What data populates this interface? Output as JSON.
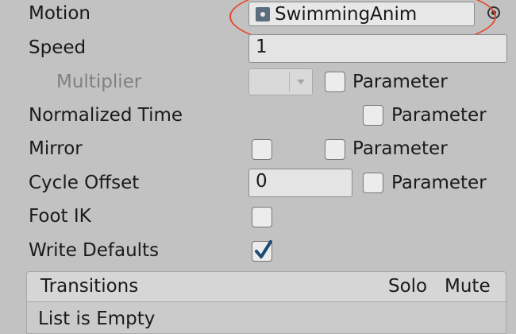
{
  "inspector": {
    "motion": {
      "label": "Motion",
      "value": "SwimmingAnim"
    },
    "speed": {
      "label": "Speed",
      "value": "1"
    },
    "multiplier": {
      "label": "Multiplier",
      "param_label": "Parameter"
    },
    "normalized_time": {
      "label": "Normalized Time",
      "param_label": "Parameter"
    },
    "mirror": {
      "label": "Mirror",
      "param_label": "Parameter"
    },
    "cycle_offset": {
      "label": "Cycle Offset",
      "value": "0",
      "param_label": "Parameter"
    },
    "foot_ik": {
      "label": "Foot IK"
    },
    "write_defaults": {
      "label": "Write Defaults",
      "checked": true
    }
  },
  "transitions": {
    "title": "Transitions",
    "solo_label": "Solo",
    "mute_label": "Mute",
    "list_empty": "List is Empty"
  },
  "colors": {
    "highlight": "#e8452c",
    "check": "#1f4a73"
  }
}
